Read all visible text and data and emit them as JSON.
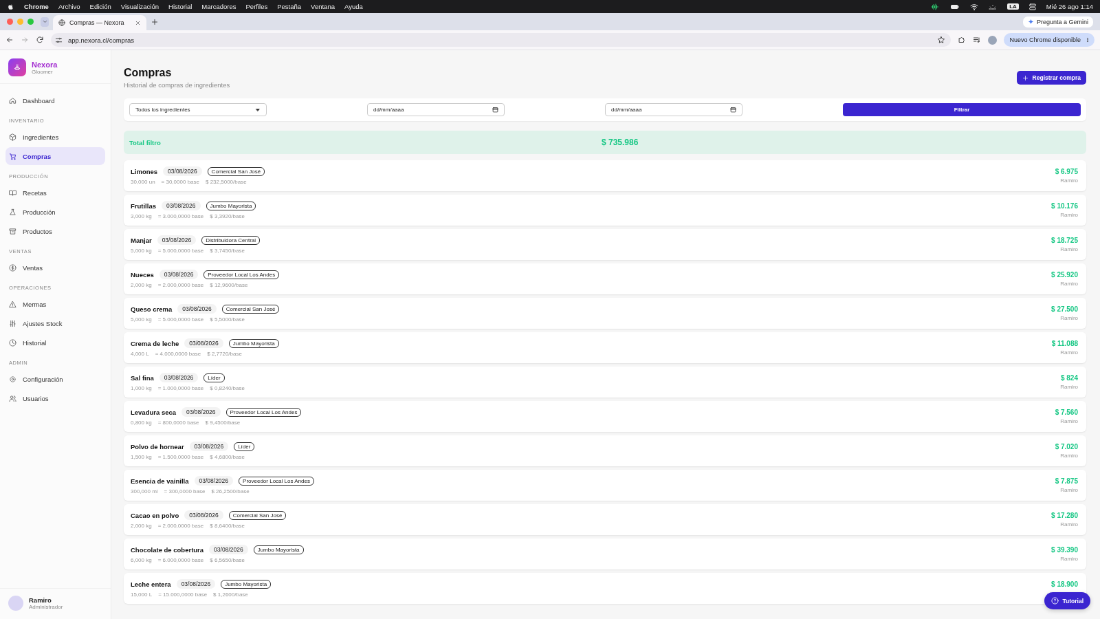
{
  "menubar": {
    "items": [
      "Chrome",
      "Archivo",
      "Edición",
      "Visualización",
      "Historial",
      "Marcadores",
      "Perfiles",
      "Pestaña",
      "Ventana",
      "Ayuda"
    ],
    "keyboard": "LA",
    "clock": "Mié 26 ago 1:14"
  },
  "browser": {
    "tabs": [
      {
        "title": "Compras — Nexora",
        "selected": true
      }
    ],
    "gemini": "Pregunta a Gemini",
    "url": "app.nexora.cl/compras",
    "update": "Nuevo Chrome disponible"
  },
  "sidebar": {
    "brand": "Nexora",
    "subtitle": "Gloomer",
    "nav": [
      {
        "kind": "link",
        "label": "Dashboard",
        "selected": false
      },
      {
        "kind": "heading",
        "label": "INVENTARIO"
      },
      {
        "kind": "link",
        "label": "Ingredientes",
        "selected": false
      },
      {
        "kind": "link",
        "label": "Compras",
        "selected": true
      },
      {
        "kind": "heading",
        "label": "PRODUCCIÓN"
      },
      {
        "kind": "link",
        "label": "Recetas",
        "selected": false
      },
      {
        "kind": "link",
        "label": "Producción",
        "selected": false
      },
      {
        "kind": "link",
        "label": "Productos",
        "selected": false
      },
      {
        "kind": "heading",
        "label": "VENTAS"
      },
      {
        "kind": "link",
        "label": "Ventas",
        "selected": false
      },
      {
        "kind": "heading",
        "label": "OPERACIONES"
      },
      {
        "kind": "link",
        "label": "Mermas",
        "selected": false
      },
      {
        "kind": "link",
        "label": "Ajustes Stock",
        "selected": false
      },
      {
        "kind": "link",
        "label": "Historial",
        "selected": false
      },
      {
        "kind": "heading",
        "label": "ADMIN"
      },
      {
        "kind": "link",
        "label": "Configuración",
        "selected": false
      },
      {
        "kind": "link",
        "label": "Usuarios",
        "selected": false
      }
    ],
    "user": {
      "name": "Ramiro",
      "role": "Administrador"
    }
  },
  "page": {
    "title": "Compras",
    "subtitle": "Historial de compras de ingredientes",
    "register_button": "Registrar compra",
    "filters": {
      "ingredient": "Todos los ingredientes",
      "date_from": {
        "placeholder": "dd/mm/aaaa"
      },
      "date_to": {
        "placeholder": "dd/mm/aaaa"
      },
      "button": "Filtrar"
    },
    "total": {
      "label": "Total filtro",
      "value": "$ 735.986"
    },
    "purchases": [
      {
        "name": "Limones",
        "date": "03/08/2026",
        "supplier": "Comercial San José",
        "quantity": "30,000 un",
        "base": "= 30,0000 base",
        "unit_price": "$ 232,5000/base",
        "total": "$ 6.975",
        "user": "Ramiro"
      },
      {
        "name": "Frutillas",
        "date": "03/08/2026",
        "supplier": "Jumbo Mayorista",
        "quantity": "3,000 kg",
        "base": "= 3.000,0000 base",
        "unit_price": "$ 3,3920/base",
        "total": "$ 10.176",
        "user": "Ramiro"
      },
      {
        "name": "Manjar",
        "date": "03/08/2026",
        "supplier": "Distribuidora Central",
        "quantity": "5,000 kg",
        "base": "= 5.000,0000 base",
        "unit_price": "$ 3,7450/base",
        "total": "$ 18.725",
        "user": "Ramiro"
      },
      {
        "name": "Nueces",
        "date": "03/08/2026",
        "supplier": "Proveedor Local Los Andes",
        "quantity": "2,000 kg",
        "base": "= 2.000,0000 base",
        "unit_price": "$ 12,9600/base",
        "total": "$ 25.920",
        "user": "Ramiro"
      },
      {
        "name": "Queso crema",
        "date": "03/08/2026",
        "supplier": "Comercial San José",
        "quantity": "5,000 kg",
        "base": "= 5.000,0000 base",
        "unit_price": "$ 5,5000/base",
        "total": "$ 27.500",
        "user": "Ramiro"
      },
      {
        "name": "Crema de leche",
        "date": "03/08/2026",
        "supplier": "Jumbo Mayorista",
        "quantity": "4,000 L",
        "base": "= 4.000,0000 base",
        "unit_price": "$ 2,7720/base",
        "total": "$ 11.088",
        "user": "Ramiro"
      },
      {
        "name": "Sal fina",
        "date": "03/08/2026",
        "supplier": "Líder",
        "quantity": "1,000 kg",
        "base": "= 1.000,0000 base",
        "unit_price": "$ 0,8240/base",
        "total": "$ 824",
        "user": "Ramiro"
      },
      {
        "name": "Levadura seca",
        "date": "03/08/2026",
        "supplier": "Proveedor Local Los Andes",
        "quantity": "0,800 kg",
        "base": "= 800,0000 base",
        "unit_price": "$ 9,4500/base",
        "total": "$ 7.560",
        "user": "Ramiro"
      },
      {
        "name": "Polvo de hornear",
        "date": "03/08/2026",
        "supplier": "Líder",
        "quantity": "1,500 kg",
        "base": "= 1.500,0000 base",
        "unit_price": "$ 4,6800/base",
        "total": "$ 7.020",
        "user": "Ramiro"
      },
      {
        "name": "Esencia de vainilla",
        "date": "03/08/2026",
        "supplier": "Proveedor Local Los Andes",
        "quantity": "300,000 ml",
        "base": "= 300,0000 base",
        "unit_price": "$ 26,2500/base",
        "total": "$ 7.875",
        "user": "Ramiro"
      },
      {
        "name": "Cacao en polvo",
        "date": "03/08/2026",
        "supplier": "Comercial San José",
        "quantity": "2,000 kg",
        "base": "= 2.000,0000 base",
        "unit_price": "$ 8,6400/base",
        "total": "$ 17.280",
        "user": "Ramiro"
      },
      {
        "name": "Chocolate de cobertura",
        "date": "03/08/2026",
        "supplier": "Jumbo Mayorista",
        "quantity": "6,000 kg",
        "base": "= 6.000,0000 base",
        "unit_price": "$ 6,5650/base",
        "total": "$ 39.390",
        "user": "Ramiro"
      },
      {
        "name": "Leche entera",
        "date": "03/08/2026",
        "supplier": "Jumbo Mayorista",
        "quantity": "15,000 L",
        "base": "= 15.000,0000 base",
        "unit_price": "$ 1,2600/base",
        "total": "$ 18.900"
      }
    ],
    "tutorial_button": "Tutorial"
  }
}
